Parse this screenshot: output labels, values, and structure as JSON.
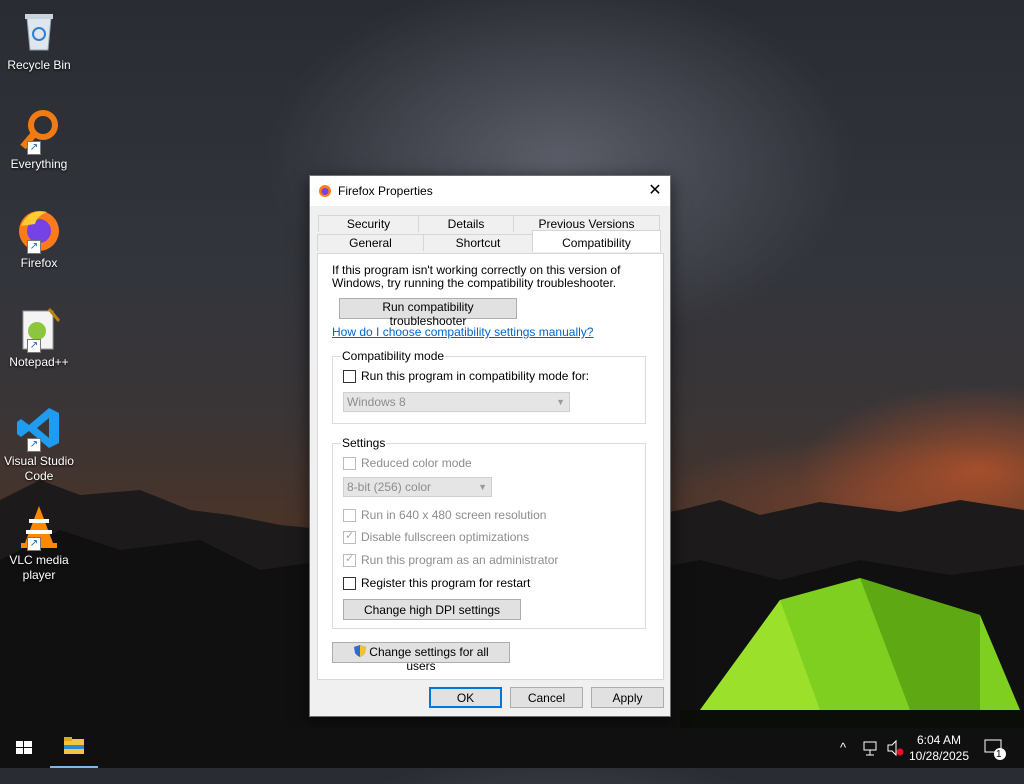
{
  "desktop_icons": [
    {
      "label": "Recycle Bin",
      "icon": "recycle-bin-icon"
    },
    {
      "label": "Everything",
      "icon": "everything-search-icon"
    },
    {
      "label": "Firefox",
      "icon": "firefox-icon"
    },
    {
      "label": "Notepad++",
      "icon": "notepad-plus-plus-icon"
    },
    {
      "label": "Visual Studio Code",
      "icon": "vscode-icon"
    },
    {
      "label": "VLC media player",
      "icon": "vlc-icon"
    }
  ],
  "dialog": {
    "title": "Firefox Properties",
    "close_glyph": "✕",
    "tabs_top": [
      "Security",
      "Details",
      "Previous Versions"
    ],
    "tabs_bottom": [
      "General",
      "Shortcut",
      "Compatibility"
    ],
    "active_tab": "Compatibility",
    "intro": "If this program isn't working correctly on this version of Windows, try running the compatibility troubleshooter.",
    "troubleshooter_button": "Run compatibility troubleshooter",
    "help_link": "How do I choose compatibility settings manually?",
    "compat_group": {
      "title": "Compatibility mode",
      "checkbox_label": "Run this program in compatibility mode for:",
      "checked": false,
      "os_select": "Windows 8"
    },
    "settings_group": {
      "title": "Settings",
      "reduced_color": {
        "label": "Reduced color mode",
        "checked": false,
        "enabled": false
      },
      "color_select": "8-bit (256) color",
      "run_640": {
        "label": "Run in 640 x 480 screen resolution",
        "checked": false,
        "enabled": false
      },
      "disable_fullscreen": {
        "label": "Disable fullscreen optimizations",
        "checked": true,
        "enabled": false
      },
      "run_admin": {
        "label": "Run this program as an administrator",
        "checked": true,
        "enabled": false
      },
      "register_restart": {
        "label": "Register this program for restart",
        "checked": false,
        "enabled": true
      },
      "dpi_button": "Change high DPI settings"
    },
    "all_users_button": "Change settings for all users",
    "ok_button": "OK",
    "cancel_button": "Cancel",
    "apply_button": "Apply"
  },
  "taskbar": {
    "time": "6:04 AM",
    "date": "10/28/2025",
    "notification_count": "1",
    "tray_chevron": "^"
  },
  "colors": {
    "accent": "#0078d7",
    "link": "#0066cc",
    "taskbar": "#101010"
  }
}
